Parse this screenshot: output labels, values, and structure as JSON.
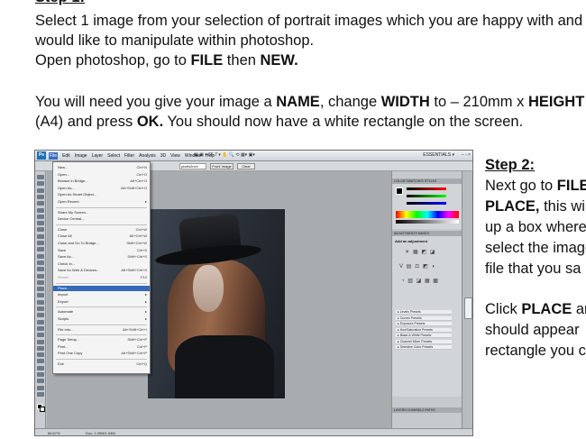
{
  "step1": {
    "heading": "Step 1:",
    "line1": "Select 1 image from your selection of portrait images which you are happy with and",
    "line2": "would like to manipulate within photoshop.",
    "line3_a": "Open photoshop, go to ",
    "line3_file": "FILE",
    "line3_b": " then ",
    "line3_new": "NEW.",
    "line4_a": "You will need you give your image a ",
    "line4_name": "NAME",
    "line4_b": ", change ",
    "line4_width": "WIDTH",
    "line4_c": " to – 210mm x ",
    "line4_height": "HEIGHT",
    "line5_a": "(A4) and press ",
    "line5_ok": "OK.",
    "line5_b": " You should now have a white rectangle on the screen."
  },
  "step2": {
    "heading": "Step 2:",
    "line1_a": "Next go to ",
    "line1_file": "FILE",
    "line2_place": "PLACE,",
    "line2_b": " this will",
    "line3": "up a box where",
    "line4": "select the image",
    "line5": "file that you sa",
    "line6_a": "Click ",
    "line6_place": "PLACE",
    "line6_b": " an",
    "line7": "should appear",
    "line8": "rectangle you c"
  },
  "photoshop": {
    "logo": "Ps",
    "menus": [
      "File",
      "Edit",
      "Image",
      "Layer",
      "Select",
      "Filter",
      "Analysis",
      "3D",
      "View",
      "Window",
      "Help"
    ],
    "active_menu": "File",
    "toolbar_extras": "▣ ▣ ▾ 66.7 ▾  ✋ 🔍 ⟲  ▦▾  ▣▾",
    "essentials": "ESSENTIALS ▾",
    "window_controls": "– ▫ ×",
    "options": {
      "resolution_unit": "pixels/inch",
      "front_image": "Front Image",
      "clear": "Clear"
    },
    "file_menu": [
      {
        "label": "New...",
        "shortcut": "Ctrl+N"
      },
      {
        "label": "Open...",
        "shortcut": "Ctrl+O"
      },
      {
        "label": "Browse in Bridge...",
        "shortcut": "Alt+Ctrl+O"
      },
      {
        "label": "Open As...",
        "shortcut": "Alt+Shift+Ctrl+O"
      },
      {
        "label": "Open As Smart Object...",
        "shortcut": ""
      },
      {
        "label": "Open Recent",
        "shortcut": "▸"
      },
      {
        "label": "Share My Screen...",
        "shortcut": ""
      },
      {
        "label": "Device Central...",
        "shortcut": ""
      },
      {
        "label": "Close",
        "shortcut": "Ctrl+W"
      },
      {
        "label": "Close All",
        "shortcut": "Alt+Ctrl+W"
      },
      {
        "label": "Close and Go To Bridge...",
        "shortcut": "Shift+Ctrl+W"
      },
      {
        "label": "Save",
        "shortcut": "Ctrl+S"
      },
      {
        "label": "Save As...",
        "shortcut": "Shift+Ctrl+S"
      },
      {
        "label": "Check In...",
        "shortcut": ""
      },
      {
        "label": "Save for Web & Devices...",
        "shortcut": "Alt+Shift+Ctrl+S"
      },
      {
        "label": "Revert",
        "shortcut": "F12"
      },
      {
        "label": "Place...",
        "shortcut": ""
      },
      {
        "label": "Import",
        "shortcut": "▸"
      },
      {
        "label": "Export",
        "shortcut": "▸"
      },
      {
        "label": "Automate",
        "shortcut": "▸"
      },
      {
        "label": "Scripts",
        "shortcut": "▸"
      },
      {
        "label": "File Info...",
        "shortcut": "Alt+Shift+Ctrl+I"
      },
      {
        "label": "Page Setup...",
        "shortcut": "Shift+Ctrl+P"
      },
      {
        "label": "Print...",
        "shortcut": "Ctrl+P"
      },
      {
        "label": "Print One Copy",
        "shortcut": "Alt+Shift+Ctrl+P"
      },
      {
        "label": "Exit",
        "shortcut": "Ctrl+Q"
      }
    ],
    "panels": {
      "color_tabs": "COLOR   SWATCHES   STYLES",
      "adjust_tabs": "ADJUSTMENTS   MASKS",
      "adjust_title": "Add an adjustment",
      "adjust_icons_1": "☀ ▦ ◩ ◪",
      "adjust_icons_2": "V ▤ ⚖ ◩ ◑",
      "adjust_icons_3": "◔ ▧ ◪ ▦ ▩",
      "presets": [
        "Levels Presets",
        "Curves Presets",
        "Exposure Presets",
        "Hue/Saturation Presets",
        "Black & White Presets",
        "Channel Mixer Presets",
        "Selective Color Presets"
      ],
      "layers_tabs": "LAYERS   CHANNELS   PATHS"
    },
    "status": {
      "zoom": "66.67%",
      "doc": "Doc: 1.09M/1.94M"
    }
  }
}
